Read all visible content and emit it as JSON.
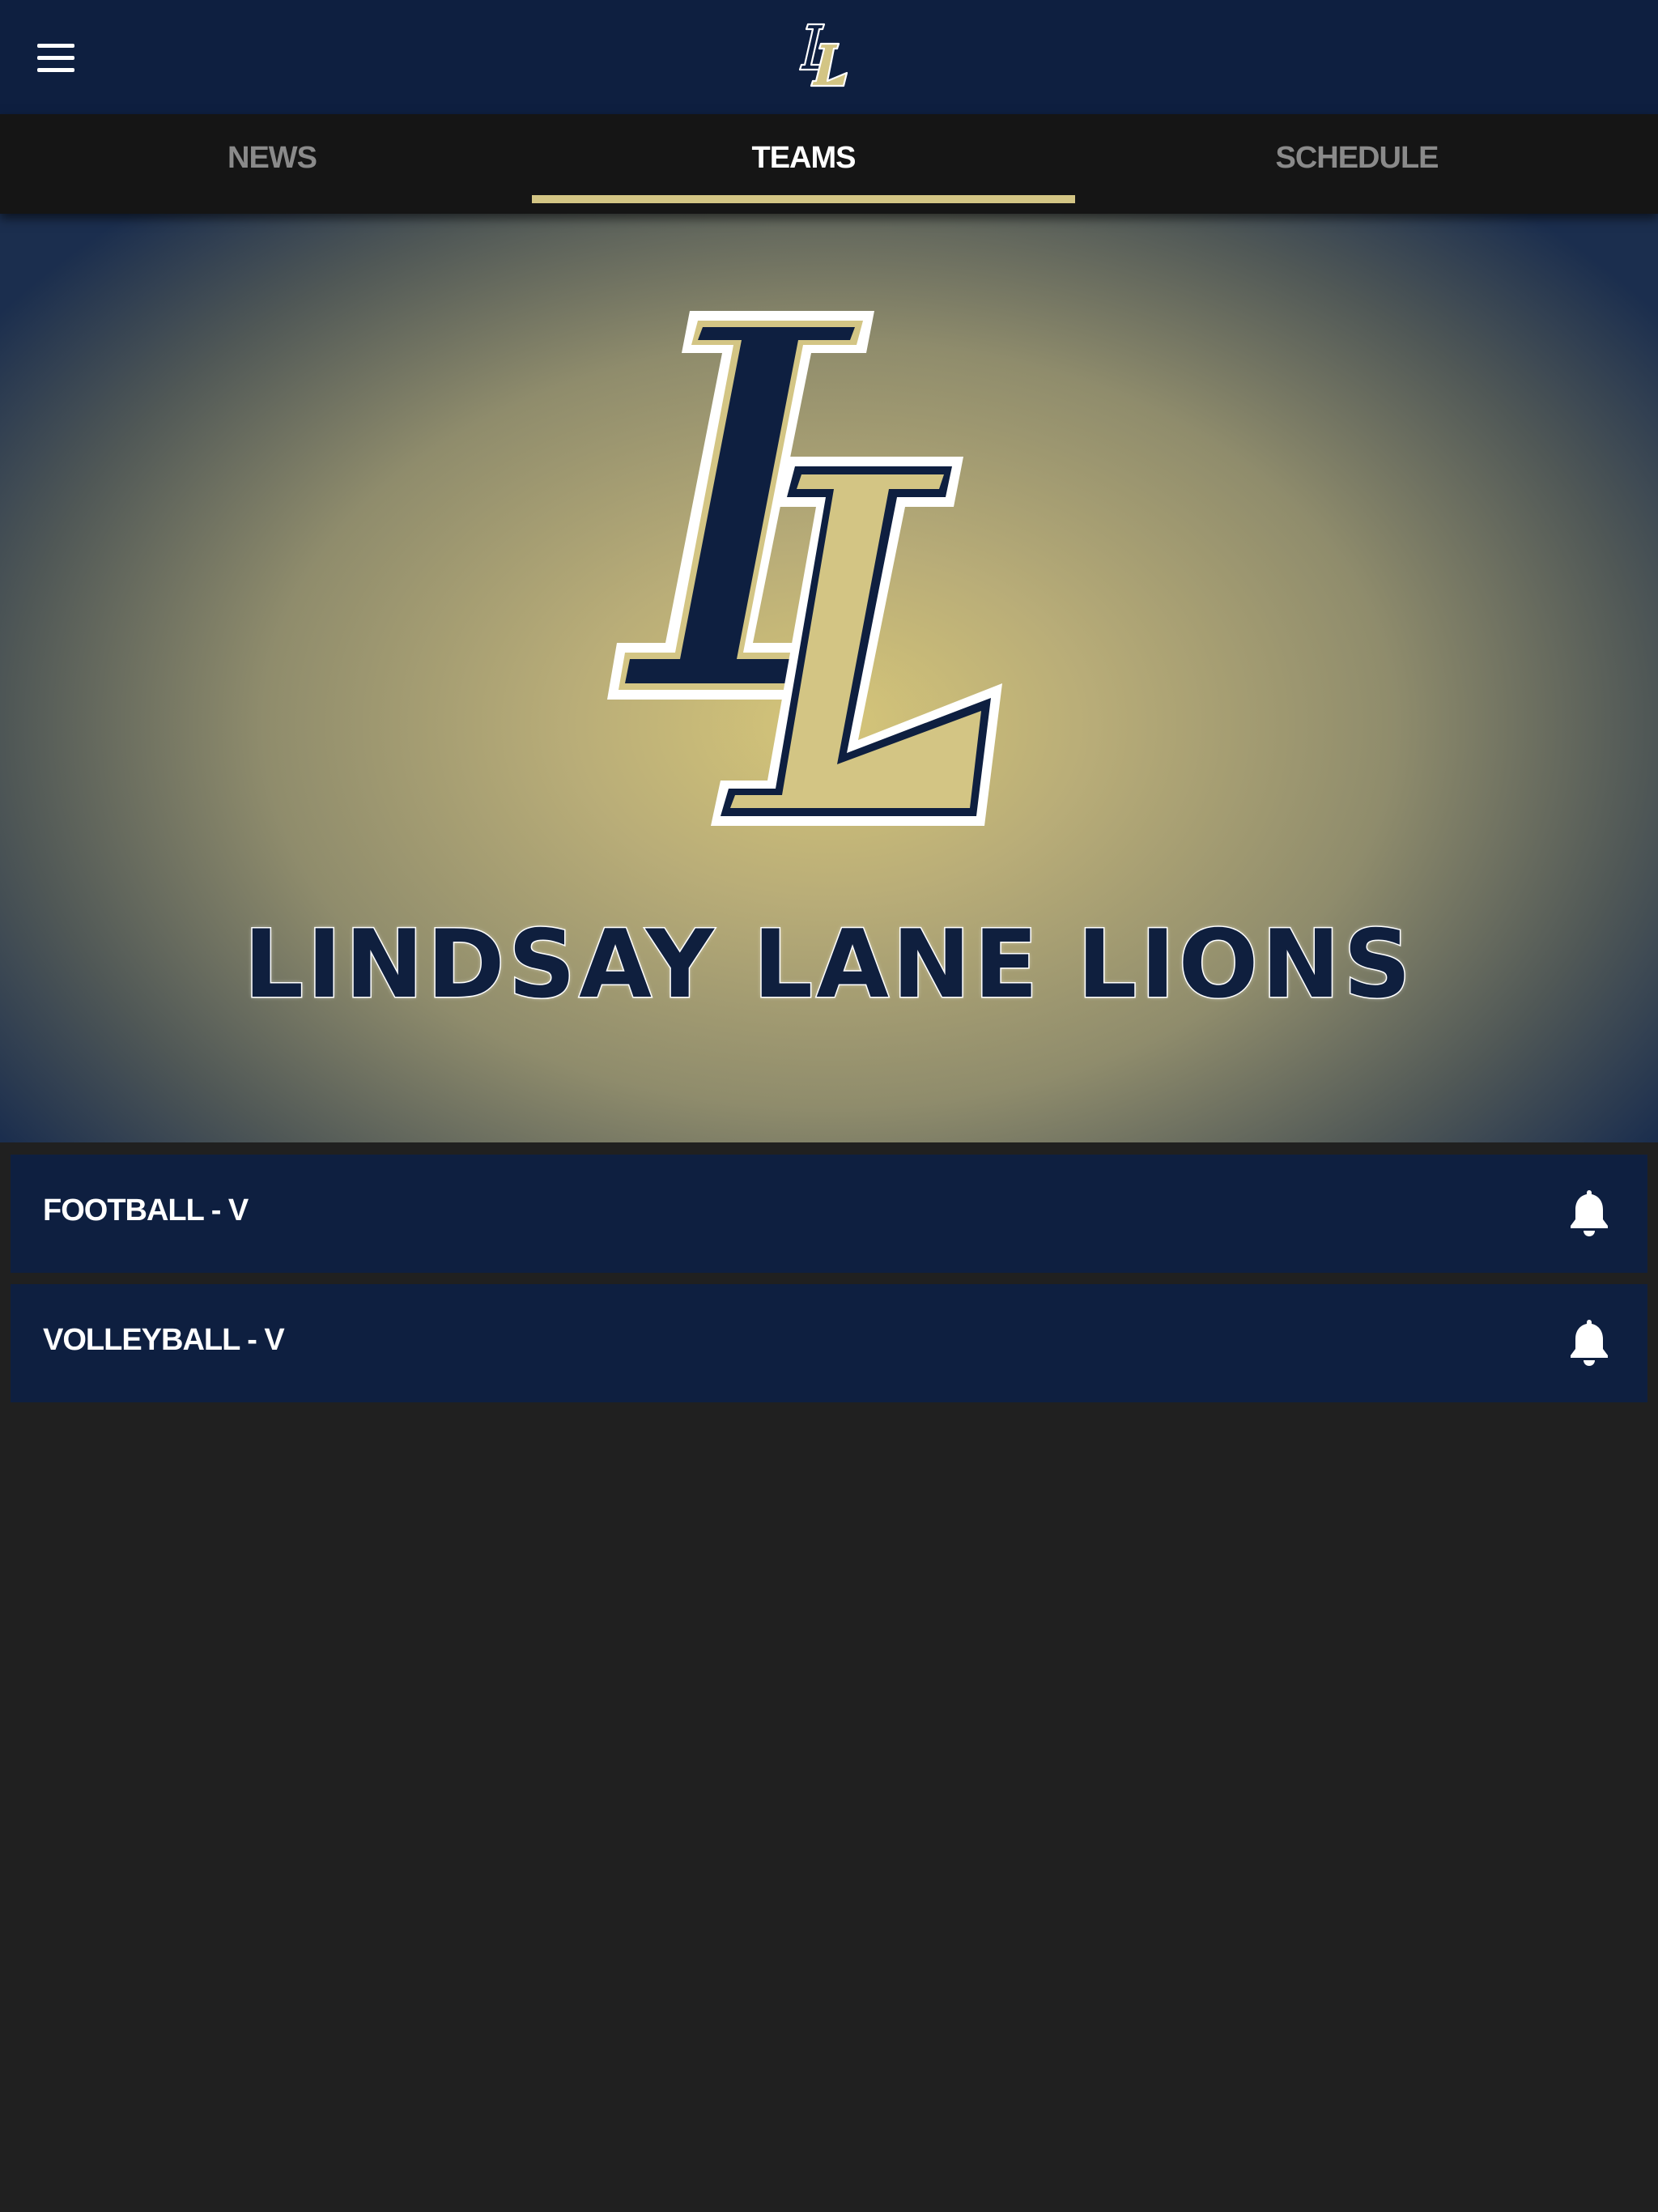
{
  "header": {
    "menu_icon": "hamburger-menu-icon",
    "logo": "LL",
    "colors": {
      "navy": "#0e1f40",
      "gold": "#d3c584"
    }
  },
  "tabs": [
    {
      "label": "NEWS",
      "active": false
    },
    {
      "label": "TEAMS",
      "active": true
    },
    {
      "label": "SCHEDULE",
      "active": false
    }
  ],
  "hero": {
    "logo": "LL",
    "title": "LINDSAY LANE LIONS"
  },
  "teams": [
    {
      "name": "FOOTBALL - V",
      "icon": "bell-icon"
    },
    {
      "name": "VOLLEYBALL - V",
      "icon": "bell-icon"
    }
  ]
}
